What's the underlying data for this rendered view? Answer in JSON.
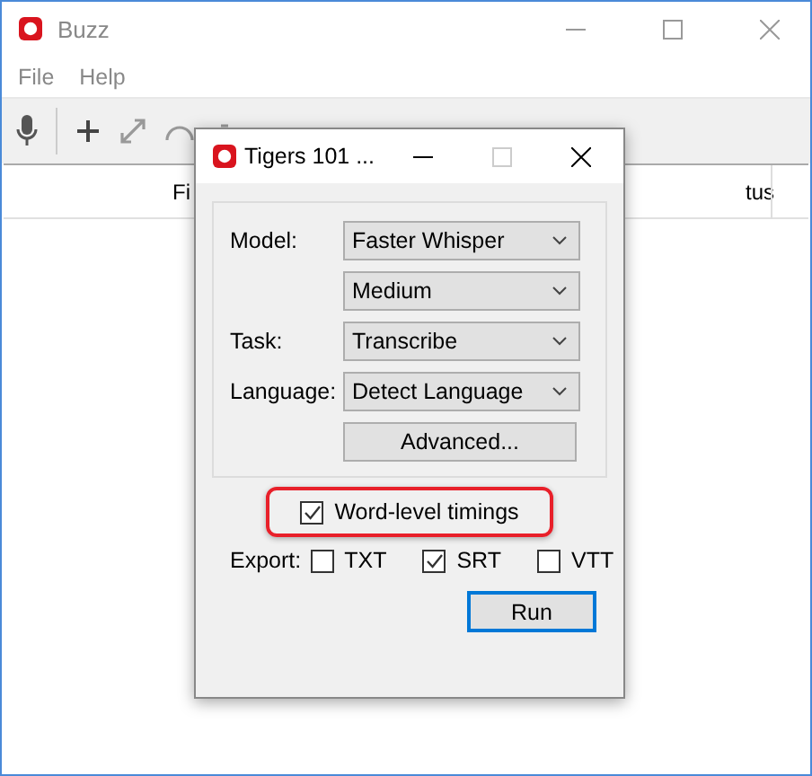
{
  "window": {
    "title": "Buzz"
  },
  "menu": [
    "File",
    "Help"
  ],
  "table": {
    "columns": [
      "Fi",
      "tus"
    ]
  },
  "dialog": {
    "title": "Tigers 101 ...",
    "fields": [
      {
        "label": "Model:",
        "value": "Faster Whisper"
      },
      {
        "value": "Medium"
      },
      {
        "label": "Task:",
        "value": "Transcribe"
      },
      {
        "label": "Language:",
        "value": "Detect Language"
      }
    ],
    "advanced_button": "Advanced...",
    "word_level": {
      "label": "Word-level timings",
      "checked": true,
      "highlighted": true
    },
    "export": {
      "label": "Export:",
      "options": [
        {
          "label": "TXT",
          "checked": false
        },
        {
          "label": "SRT",
          "checked": true
        },
        {
          "label": "VTT",
          "checked": false
        }
      ]
    },
    "run_button": "Run"
  }
}
